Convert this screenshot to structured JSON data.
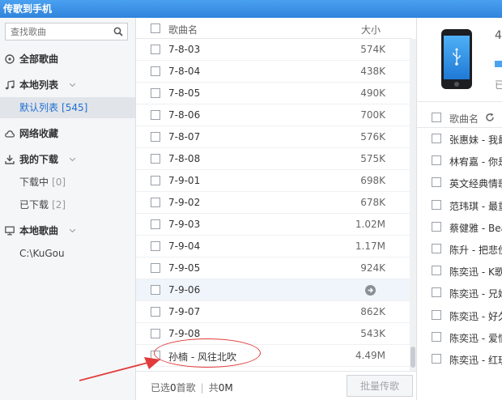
{
  "window": {
    "title": "传歌到手机"
  },
  "sidebar": {
    "search_placeholder": "查找歌曲",
    "all_songs": "全部歌曲",
    "local_lists": "本地列表",
    "default_list": {
      "label": "默认列表",
      "count": "[545]"
    },
    "net_favorites": "网络收藏",
    "my_downloads": "我的下载",
    "downloading": {
      "label": "下载中",
      "count": "[0]"
    },
    "downloaded": {
      "label": "已下载",
      "count": "[2]"
    },
    "local_songs": "本地歌曲",
    "local_path": "C:\\KuGou"
  },
  "songlist": {
    "header_name": "歌曲名",
    "header_size": "大小",
    "rows": [
      {
        "name": "7-8-03",
        "size": "574K"
      },
      {
        "name": "7-8-04",
        "size": "438K"
      },
      {
        "name": "7-8-05",
        "size": "490K"
      },
      {
        "name": "7-8-06",
        "size": "700K"
      },
      {
        "name": "7-8-07",
        "size": "576K"
      },
      {
        "name": "7-8-08",
        "size": "575K"
      },
      {
        "name": "7-9-01",
        "size": "698K"
      },
      {
        "name": "7-9-02",
        "size": "678K"
      },
      {
        "name": "7-9-03",
        "size": "1.02M"
      },
      {
        "name": "7-9-04",
        "size": "1.17M"
      },
      {
        "name": "7-9-05",
        "size": "924K"
      },
      {
        "name": "7-9-06",
        "size": ""
      },
      {
        "name": "7-9-07",
        "size": "862K"
      },
      {
        "name": "7-9-08",
        "size": "543K"
      },
      {
        "name": "孙楠 - 风往北吹",
        "size": "4.49M"
      }
    ],
    "footer": {
      "selected_prefix": "已选",
      "selected_count": "0",
      "selected_suffix": "首歌",
      "total_prefix": "共",
      "total_size": "0M",
      "batch_button": "批量传歌"
    }
  },
  "phone_panel": {
    "top_char": "4",
    "status_char": "已",
    "header_name": "歌曲名",
    "songs": [
      "张惠妹 - 我最",
      "林宥嘉 - 你是",
      "英文经典情歌",
      "范玮琪 - 最重",
      "蔡健雅 - Beau",
      "陈升 - 把悲伤",
      "陈奕迅 - K歌",
      "陈奕迅 - 兄妹",
      "陈奕迅 - 好久",
      "陈奕迅 - 爱情",
      "陈奕迅 - 红玫"
    ]
  },
  "colors": {
    "titlebar": "#3a8ee6",
    "accent": "#1f6fd1",
    "annotation": "#e23b3b"
  }
}
